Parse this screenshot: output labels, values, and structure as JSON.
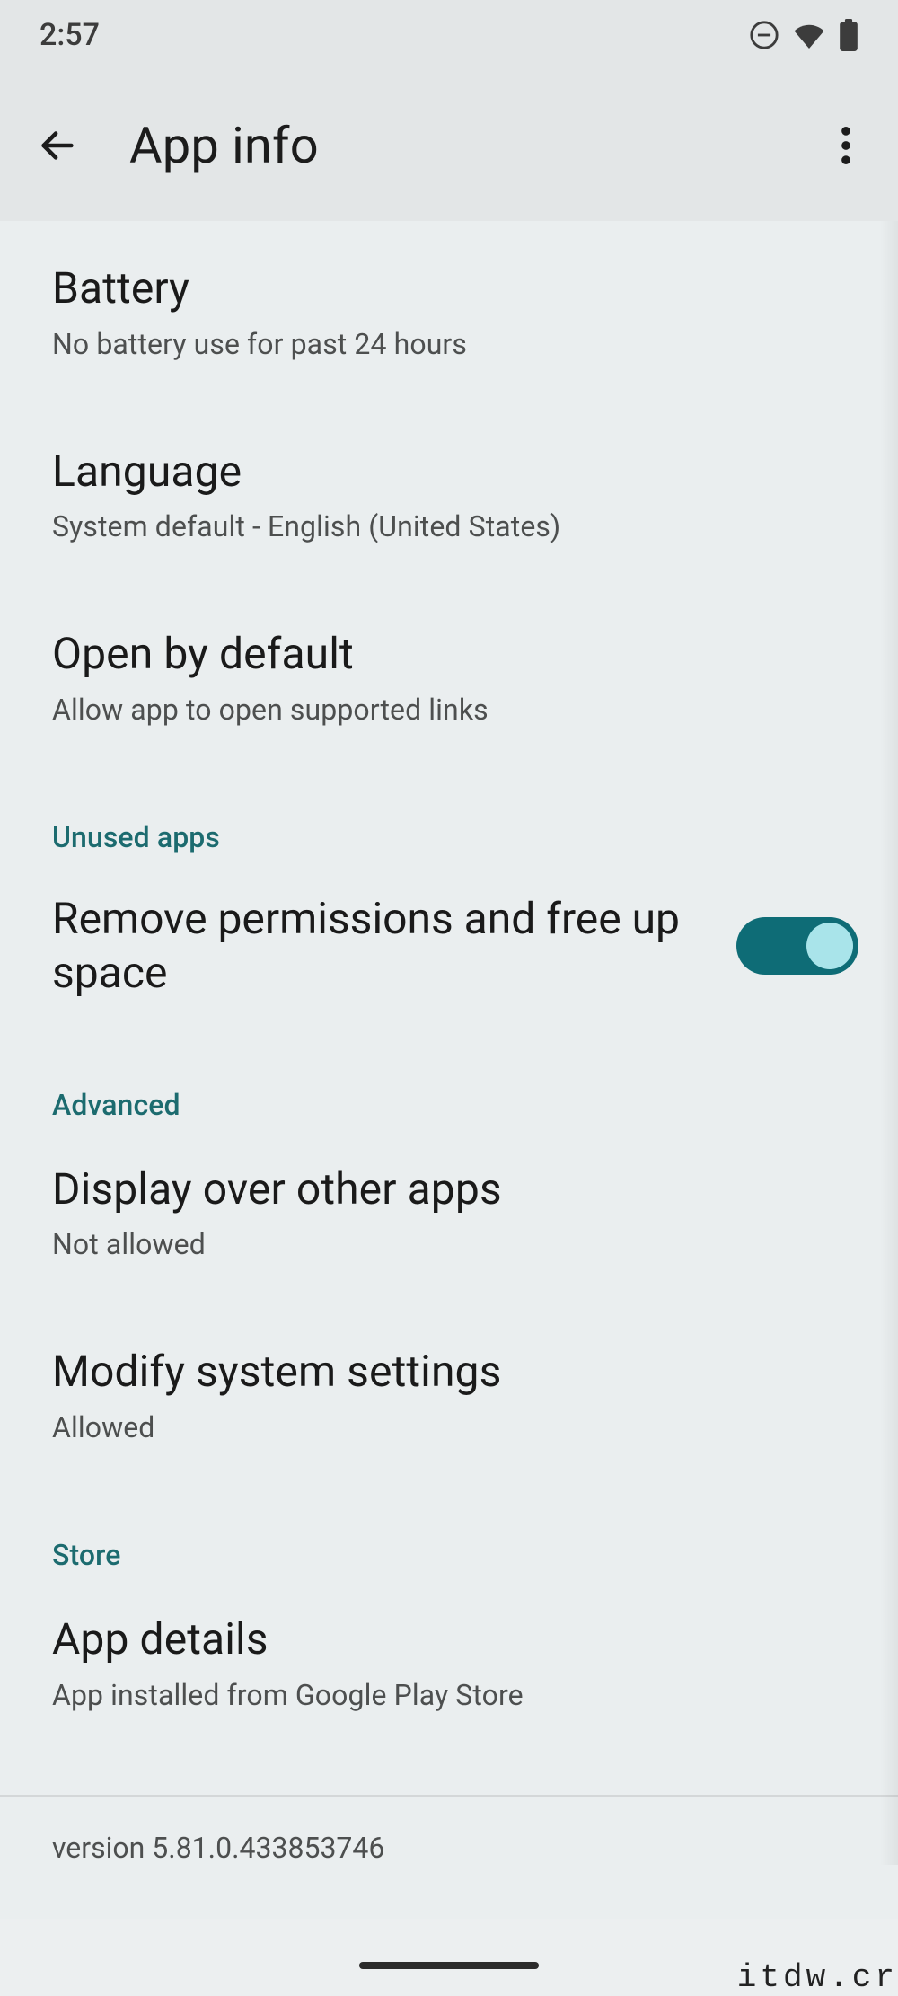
{
  "status": {
    "time": "2:57"
  },
  "header": {
    "title": "App info"
  },
  "items": {
    "battery": {
      "title": "Battery",
      "subtitle": "No battery use for past 24 hours"
    },
    "language": {
      "title": "Language",
      "subtitle": "System default - English (United States)"
    },
    "open_default": {
      "title": "Open by default",
      "subtitle": "Allow app to open supported links"
    },
    "remove_perms": {
      "title": "Remove permissions and free up space"
    },
    "display_over": {
      "title": "Display over other apps",
      "subtitle": "Not allowed"
    },
    "modify_system": {
      "title": "Modify system settings",
      "subtitle": "Allowed"
    },
    "app_details": {
      "title": "App details",
      "subtitle": "App installed from Google Play Store"
    }
  },
  "sections": {
    "unused": "Unused apps",
    "advanced": "Advanced",
    "store": "Store"
  },
  "version": "version 5.81.0.433853746",
  "watermark": "itdw.cr"
}
